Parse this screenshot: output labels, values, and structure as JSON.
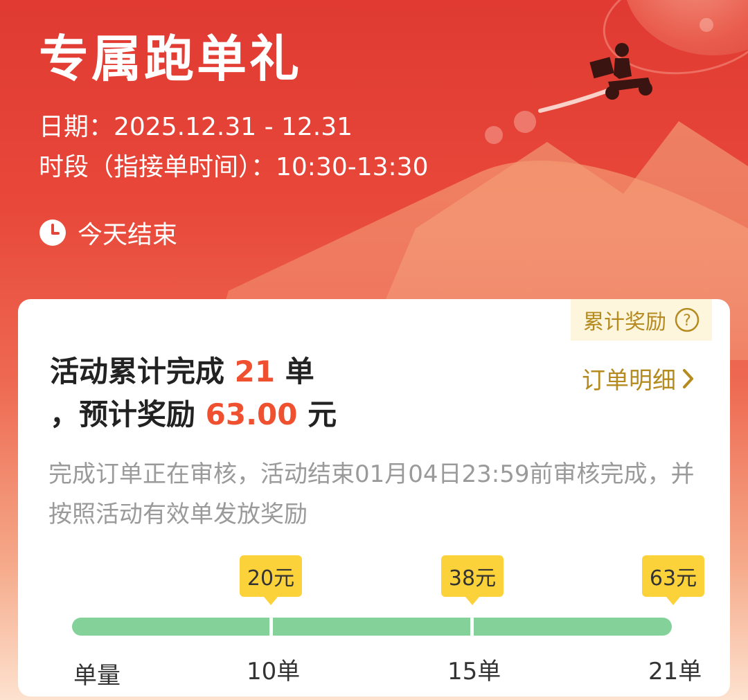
{
  "header": {
    "title": "专属跑单礼",
    "date_line": "日期：2025.12.31 - 12.31",
    "period_line": "时段（指接单时间）：10:30-13:30",
    "ends_label": "今天结束"
  },
  "card": {
    "reward_tag_label": "累计奖励",
    "detail_link_label": "订单明细",
    "summary": {
      "prefix": "活动累计完成 ",
      "orders": "21",
      "orders_unit": " 单",
      "line2_prefix": "，预计奖励 ",
      "amount": "63.00",
      "amount_unit": " 元"
    },
    "note": "完成订单正在审核，活动结束01月04日23:59前审核完成，并按照活动有效单发放奖励"
  },
  "progress": {
    "axis_title": "单量",
    "tiers": [
      {
        "reward": "20元",
        "threshold": "10单"
      },
      {
        "reward": "38元",
        "threshold": "15单"
      },
      {
        "reward": "63元",
        "threshold": "21单"
      }
    ],
    "completed_fraction": 1.0
  },
  "colors": {
    "accent_red": "#ef5030",
    "gold_text": "#b58a1e",
    "progress_green": "#84d19a",
    "tag_yellow": "#fcd23a"
  },
  "icons": {
    "clock": "clock-icon",
    "help": "question-circle-icon",
    "chevron": "chevron-right-icon",
    "rider": "delivery-rider-icon"
  }
}
